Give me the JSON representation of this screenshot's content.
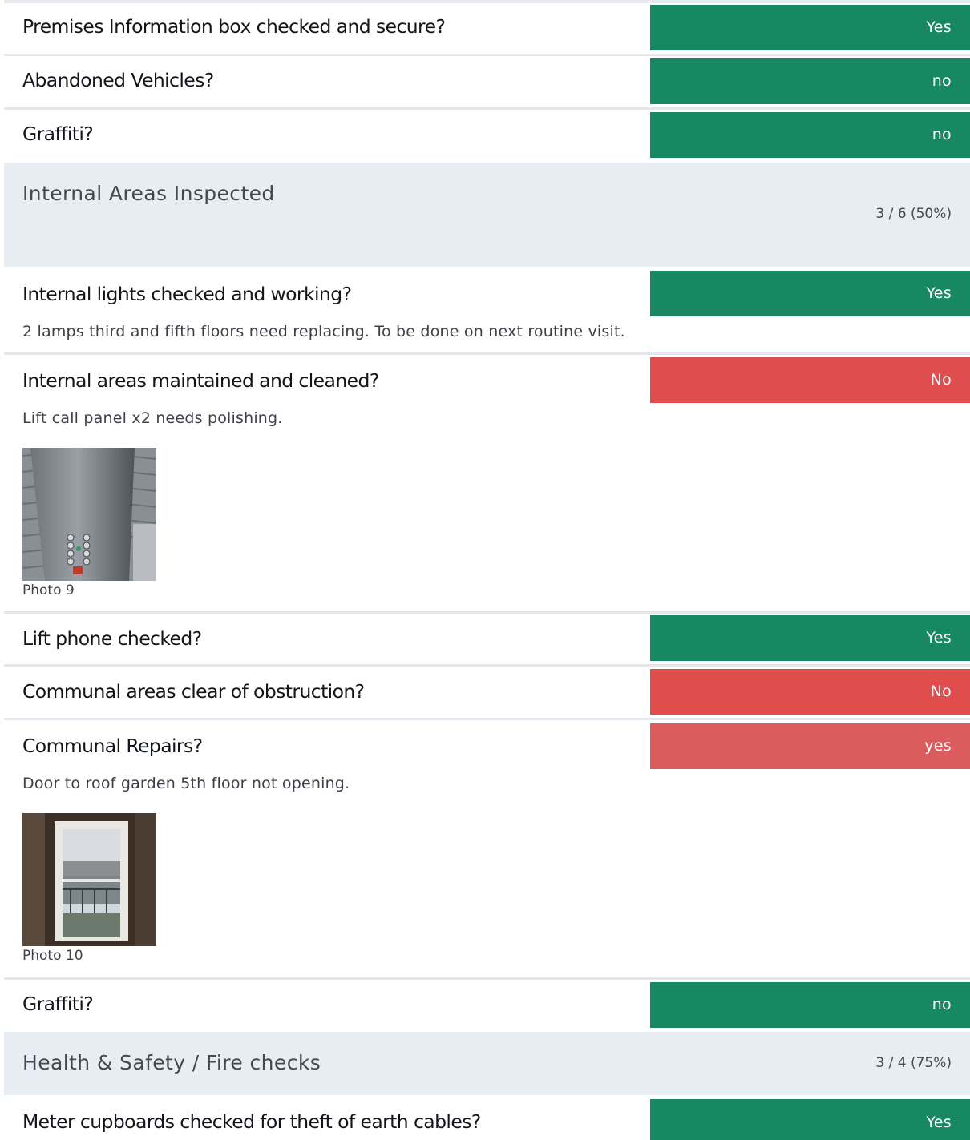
{
  "items": [
    {
      "question": "Premises Information box checked and secure?",
      "answer": "Yes",
      "status_color": "#178862"
    },
    {
      "question": "Abandoned Vehicles?",
      "answer": "no",
      "status_color": "#178862"
    },
    {
      "question": "Graffiti?",
      "answer": "no",
      "status_color": "#178862"
    }
  ],
  "internal_section": {
    "title": "Internal Areas Inspected",
    "score": "3 / 6 (50%)",
    "items": [
      {
        "question": "Internal lights checked and working?",
        "answer": "Yes",
        "note": "2 lamps third and fifth floors need replacing.  To be done on next routine visit.",
        "status_color": "#178862"
      },
      {
        "question": "Internal areas maintained and cleaned?",
        "answer": "No",
        "note": "Lift call panel x2 needs polishing.",
        "photo_caption": "Photo 9",
        "status_color": "#df4d4c"
      },
      {
        "question": "Lift phone checked?",
        "answer": "Yes",
        "status_color": "#178862"
      },
      {
        "question": "Communal areas clear of obstruction?",
        "answer": "No",
        "status_color": "#df4d4c"
      },
      {
        "question": "Communal Repairs?",
        "answer": "yes",
        "note": "Door to roof garden 5th floor not opening.",
        "photo_caption": "Photo 10",
        "status_color": "#dc5b5c"
      },
      {
        "question": "Graffiti?",
        "answer": "no",
        "status_color": "#178862"
      }
    ]
  },
  "health_section": {
    "title": "Health & Safety / Fire checks",
    "score": "3 / 4 (75%)",
    "items": [
      {
        "question": "Meter cupboards checked for theft of earth cables?",
        "answer": "Yes",
        "status_color": "#178862"
      }
    ]
  }
}
